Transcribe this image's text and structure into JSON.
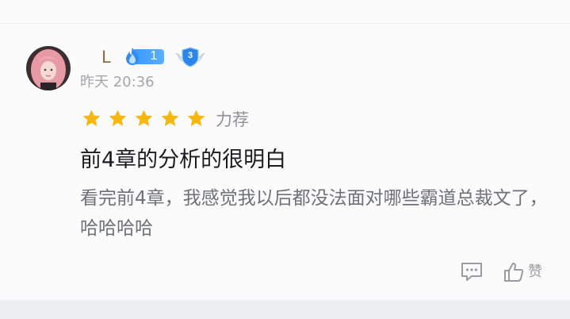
{
  "review": {
    "user": {
      "name": "L",
      "fan_level": "1",
      "member_level": "3"
    },
    "time": "昨天 20:36",
    "rating": {
      "stars": 5,
      "label": "力荐"
    },
    "title": "前4章的分析的很明白",
    "body": "看完前4章，我感觉我以后都没法面对哪些霸道总裁文了，哈哈哈哈",
    "actions": {
      "like_label": "赞"
    }
  },
  "colors": {
    "star": "#f8b70f",
    "fan_badge": "#3a98ff",
    "username": "#8a6a3e",
    "page_bg": "#eceef1",
    "card_bg": "#fbfbfc"
  },
  "icons": [
    "flame-icon",
    "shield-badge-icon",
    "star-icon",
    "comment-icon",
    "thumbs-up-icon"
  ]
}
